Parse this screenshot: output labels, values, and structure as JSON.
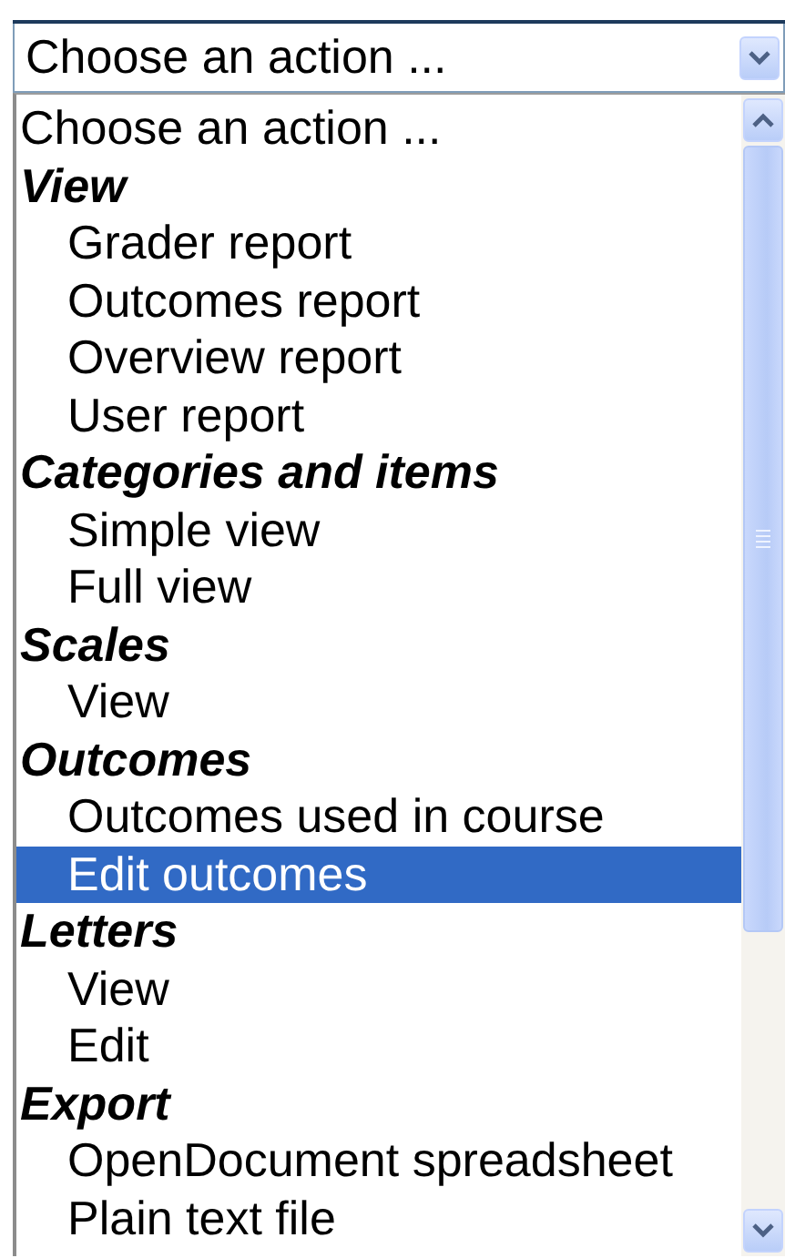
{
  "select": {
    "value": "Choose an action ..."
  },
  "options": [
    {
      "kind": "option",
      "label": "Choose an action ...",
      "indented": false,
      "selected": false
    },
    {
      "kind": "group",
      "label": "View"
    },
    {
      "kind": "option",
      "label": "Grader report",
      "indented": true,
      "selected": false
    },
    {
      "kind": "option",
      "label": "Outcomes report",
      "indented": true,
      "selected": false
    },
    {
      "kind": "option",
      "label": "Overview report",
      "indented": true,
      "selected": false
    },
    {
      "kind": "option",
      "label": "User report",
      "indented": true,
      "selected": false
    },
    {
      "kind": "group",
      "label": "Categories and items"
    },
    {
      "kind": "option",
      "label": "Simple view",
      "indented": true,
      "selected": false
    },
    {
      "kind": "option",
      "label": "Full view",
      "indented": true,
      "selected": false
    },
    {
      "kind": "group",
      "label": "Scales"
    },
    {
      "kind": "option",
      "label": "View",
      "indented": true,
      "selected": false
    },
    {
      "kind": "group",
      "label": "Outcomes"
    },
    {
      "kind": "option",
      "label": "Outcomes used in course",
      "indented": true,
      "selected": false
    },
    {
      "kind": "option",
      "label": "Edit outcomes",
      "indented": true,
      "selected": true
    },
    {
      "kind": "group",
      "label": "Letters"
    },
    {
      "kind": "option",
      "label": "View",
      "indented": true,
      "selected": false
    },
    {
      "kind": "option",
      "label": "Edit",
      "indented": true,
      "selected": false
    },
    {
      "kind": "group",
      "label": "Export"
    },
    {
      "kind": "option",
      "label": "OpenDocument spreadsheet",
      "indented": true,
      "selected": false
    },
    {
      "kind": "option",
      "label": "Plain text file",
      "indented": true,
      "selected": false
    }
  ]
}
